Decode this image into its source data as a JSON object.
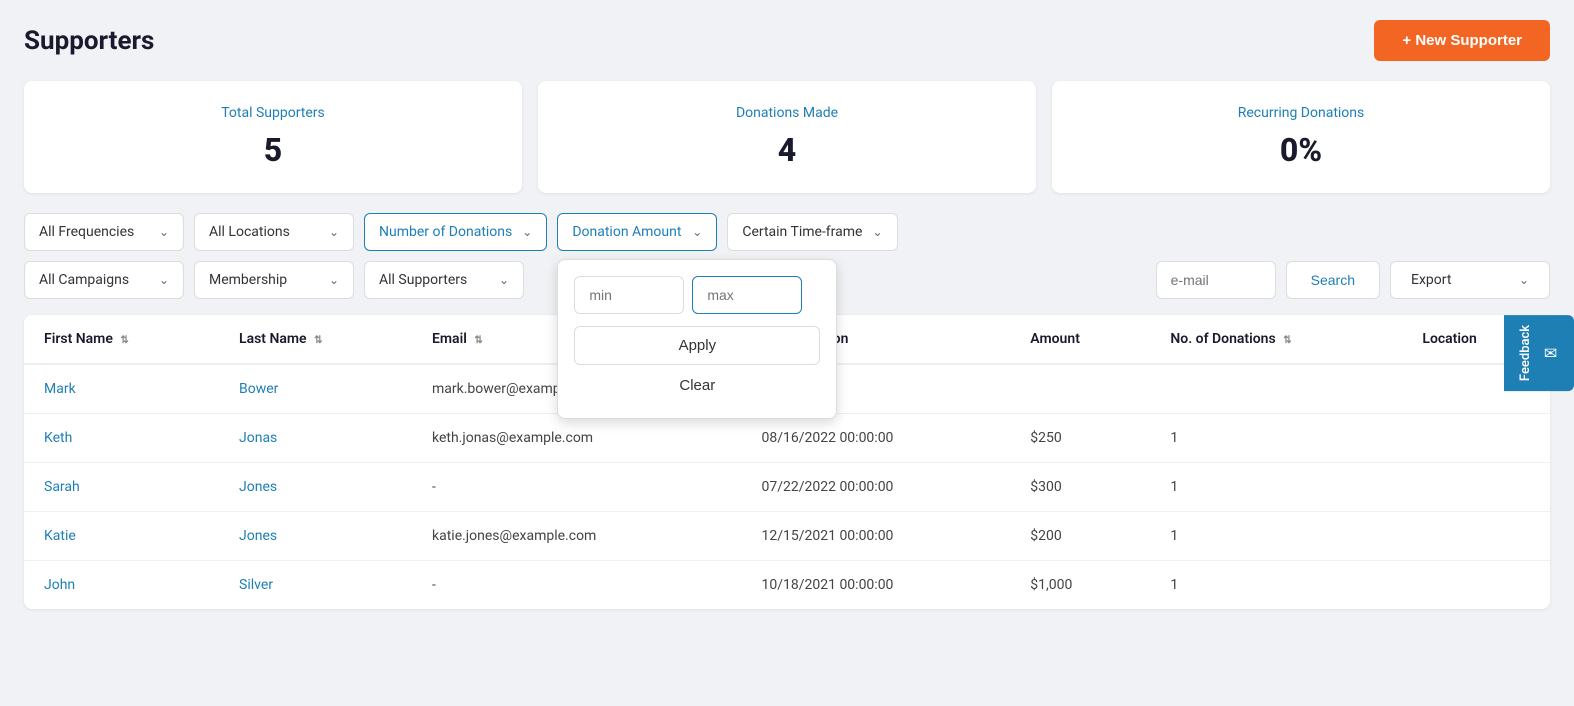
{
  "header": {
    "title": "Supporters",
    "new_supporter_btn": "+ New Supporter"
  },
  "stats": [
    {
      "label": "Total Supporters",
      "value": "5"
    },
    {
      "label": "Donations Made",
      "value": "4"
    },
    {
      "label": "Recurring Donations",
      "value": "0%"
    }
  ],
  "filters": {
    "row1": [
      {
        "id": "all-frequencies",
        "label": "All Frequencies",
        "type": "select"
      },
      {
        "id": "all-locations",
        "label": "All Locations",
        "type": "select"
      },
      {
        "id": "number-of-donations",
        "label": "Number of Donations",
        "type": "select",
        "highlighted": true
      },
      {
        "id": "donation-amount",
        "label": "Donation Amount",
        "type": "select",
        "highlighted": true
      },
      {
        "id": "certain-timeframe",
        "label": "Certain Time-frame",
        "type": "select"
      }
    ],
    "row2": [
      {
        "id": "all-campaigns",
        "label": "All Campaigns",
        "type": "select"
      },
      {
        "id": "membership",
        "label": "Membership",
        "type": "select"
      },
      {
        "id": "all-supporters",
        "label": "All Supporters",
        "type": "select"
      }
    ],
    "min_placeholder": "min",
    "max_placeholder": "max",
    "max_value": "",
    "email_label": "e-mail",
    "search_label": "Search",
    "export_label": "Export",
    "apply_label": "Apply",
    "clear_label": "Clear"
  },
  "table": {
    "columns": [
      {
        "key": "first_name",
        "label": "First Name",
        "sortable": true
      },
      {
        "key": "last_name",
        "label": "Last Name",
        "sortable": true
      },
      {
        "key": "email",
        "label": "Email",
        "sortable": true
      },
      {
        "key": "last_donation",
        "label": "Last Donation",
        "sortable": false
      },
      {
        "key": "amount",
        "label": "Amount",
        "sortable": false
      },
      {
        "key": "no_of_donations",
        "label": "No. of Donations",
        "sortable": true
      },
      {
        "key": "location",
        "label": "Location",
        "sortable": false
      }
    ],
    "rows": [
      {
        "first_name": "Mark",
        "last_name": "Bower",
        "email": "mark.bower@example.com",
        "last_donation": "-",
        "amount": "",
        "no_of_donations": "",
        "location": ""
      },
      {
        "first_name": "Keth",
        "last_name": "Jonas",
        "email": "keth.jonas@example.com",
        "last_donation": "08/16/2022 00:00:00",
        "amount": "$250",
        "no_of_donations": "1",
        "location": ""
      },
      {
        "first_name": "Sarah",
        "last_name": "Jones",
        "email": "-",
        "last_donation": "07/22/2022 00:00:00",
        "amount": "$300",
        "no_of_donations": "1",
        "location": ""
      },
      {
        "first_name": "Katie",
        "last_name": "Jones",
        "email": "katie.jones@example.com",
        "last_donation": "12/15/2021 00:00:00",
        "amount": "$200",
        "no_of_donations": "1",
        "location": ""
      },
      {
        "first_name": "John",
        "last_name": "Silver",
        "email": "-",
        "last_donation": "10/18/2021 00:00:00",
        "amount": "$1,000",
        "no_of_donations": "1",
        "location": ""
      }
    ]
  },
  "feedback": {
    "label": "Feedback"
  }
}
